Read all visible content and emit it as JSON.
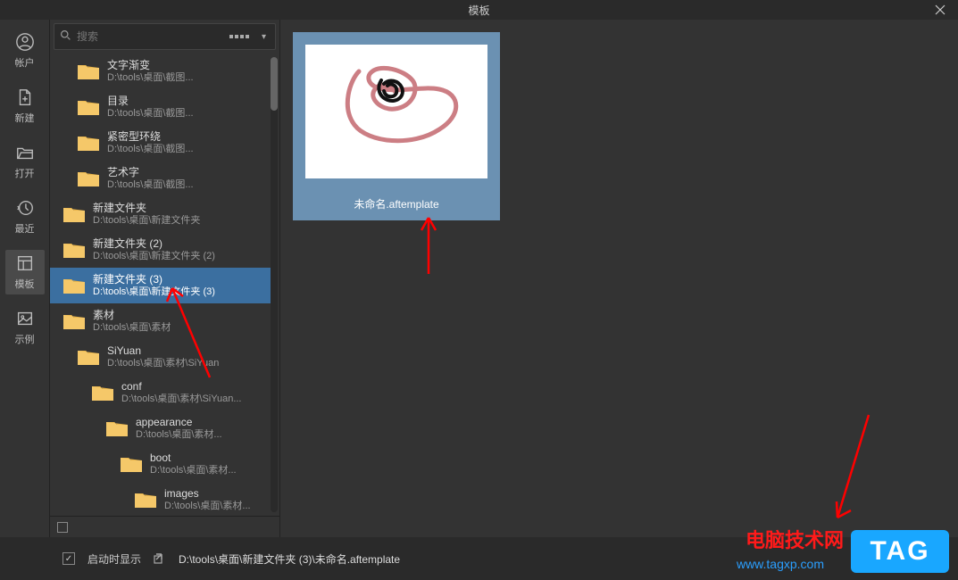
{
  "window": {
    "title": "模板"
  },
  "rail": [
    {
      "label": "帐户",
      "icon": "user"
    },
    {
      "label": "新建",
      "icon": "new"
    },
    {
      "label": "打开",
      "icon": "open"
    },
    {
      "label": "最近",
      "icon": "recent"
    },
    {
      "label": "模板",
      "icon": "template",
      "selected": true
    },
    {
      "label": "示例",
      "icon": "image"
    }
  ],
  "search": {
    "placeholder": "搜索"
  },
  "tree": [
    {
      "indent": 30,
      "title": "文字渐变",
      "path": "D:\\tools\\桌面\\截图..."
    },
    {
      "indent": 30,
      "title": "目录",
      "path": "D:\\tools\\桌面\\截图..."
    },
    {
      "indent": 30,
      "title": "紧密型环绕",
      "path": "D:\\tools\\桌面\\截图..."
    },
    {
      "indent": 30,
      "title": "艺术字",
      "path": "D:\\tools\\桌面\\截图..."
    },
    {
      "indent": 14,
      "title": "新建文件夹",
      "path": "D:\\tools\\桌面\\新建文件夹"
    },
    {
      "indent": 14,
      "title": "新建文件夹 (2)",
      "path": "D:\\tools\\桌面\\新建文件夹 (2)"
    },
    {
      "indent": 14,
      "title": "新建文件夹 (3)",
      "path": "D:\\tools\\桌面\\新建文件夹 (3)",
      "selected": true
    },
    {
      "indent": 14,
      "title": "素材",
      "path": "D:\\tools\\桌面\\素材"
    },
    {
      "indent": 30,
      "title": "SiYuan",
      "path": "D:\\tools\\桌面\\素材\\SiYuan"
    },
    {
      "indent": 46,
      "title": "conf",
      "path": "D:\\tools\\桌面\\素材\\SiYuan..."
    },
    {
      "indent": 62,
      "title": "appearance",
      "path": "D:\\tools\\桌面\\素材..."
    },
    {
      "indent": 78,
      "title": "boot",
      "path": "D:\\tools\\桌面\\素材..."
    },
    {
      "indent": 94,
      "title": "images",
      "path": "D:\\tools\\桌面\\素材..."
    }
  ],
  "thumb": {
    "caption": "未命名.aftemplate"
  },
  "footer": {
    "checkbox_label": "启动时显示",
    "path": "D:\\tools\\桌面\\新建文件夹 (3)\\未命名.aftemplate"
  },
  "watermark": {
    "line1": "电脑技术网",
    "line2": "www.tagxp.com",
    "tag": "TAG"
  }
}
